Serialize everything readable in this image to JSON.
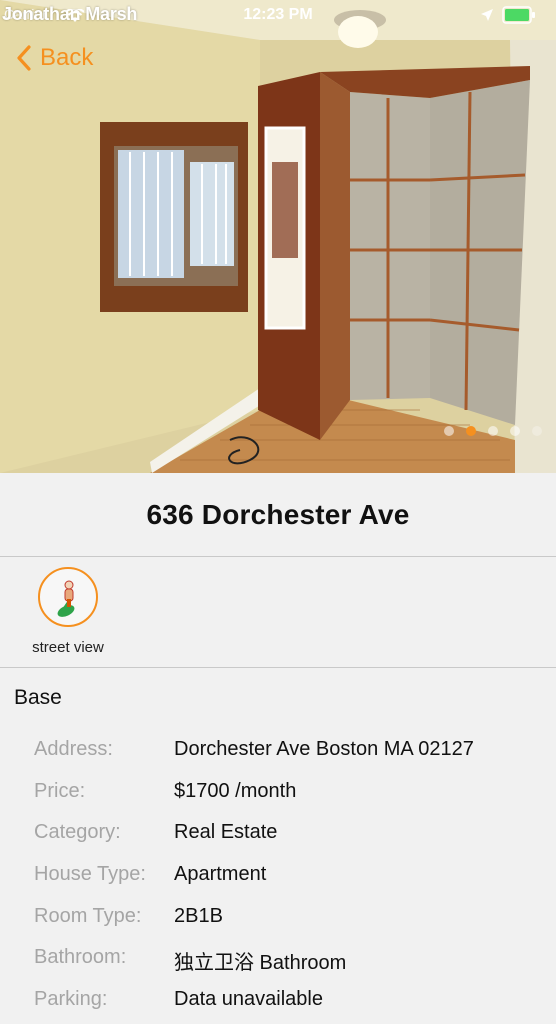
{
  "status_bar": {
    "carrier": "Jonathan Marsh",
    "carrier_overlay": "Carrier",
    "time": "12:23 PM"
  },
  "nav": {
    "back_label": "Back"
  },
  "gallery": {
    "page_count": 5,
    "current_page": 2
  },
  "listing": {
    "title": "636 Dorchester Ave"
  },
  "actions": {
    "street_view_label": "street view"
  },
  "section": {
    "title": "Base"
  },
  "details": [
    {
      "label": "Address:",
      "value": "Dorchester Ave Boston MA 02127"
    },
    {
      "label": "Price:",
      "value": "$1700 /month"
    },
    {
      "label": "Category:",
      "value": "Real Estate"
    },
    {
      "label": "House Type:",
      "value": "Apartment"
    },
    {
      "label": "Room Type:",
      "value": "2B1B"
    },
    {
      "label": "Bathroom:",
      "value": "独立卫浴 Bathroom"
    },
    {
      "label": "Parking:",
      "value": "Data unavailable"
    }
  ],
  "colors": {
    "accent": "#f5901f",
    "background": "#f1f1f1",
    "label_gray": "#a5a5a5"
  }
}
